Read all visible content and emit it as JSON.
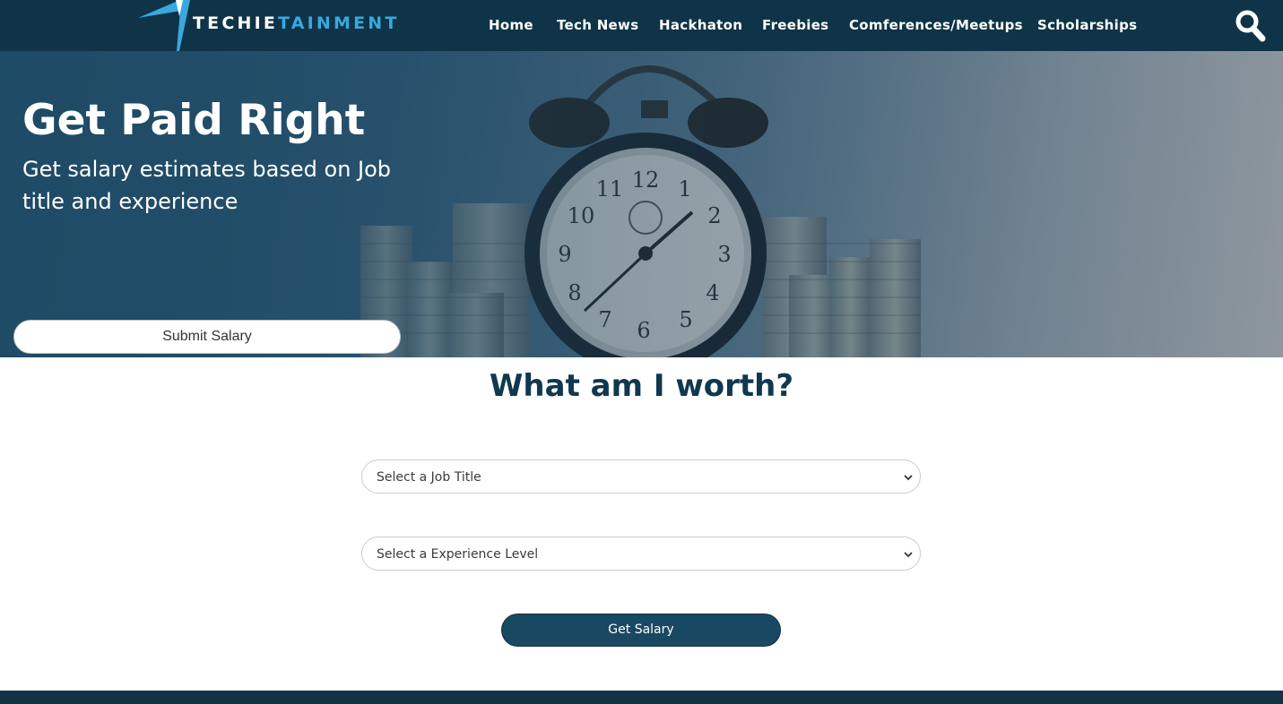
{
  "brand": {
    "text_part1": "TECHIE",
    "text_part2": "TAINMENT",
    "accent": "#3aa8e0",
    "header_bg": "#0f3347"
  },
  "nav": {
    "items": [
      {
        "label": "Home"
      },
      {
        "label": "Tech News"
      },
      {
        "label": "Hackhaton"
      },
      {
        "label": "Freebies"
      },
      {
        "label": "Comferences/Meetups"
      },
      {
        "label": "Scholarships"
      }
    ],
    "search_icon": "search-icon"
  },
  "hero": {
    "title": "Get Paid Right",
    "subtitle": "Get salary estimates based on Job title and experience",
    "submit_label": "Submit Salary"
  },
  "main": {
    "title": "What am I worth?",
    "job_select": {
      "selected": "Select a Job Title"
    },
    "experience_select": {
      "selected": "Select a Experience Level"
    },
    "get_salary_label": "Get Salary",
    "button_color": "#194862"
  }
}
